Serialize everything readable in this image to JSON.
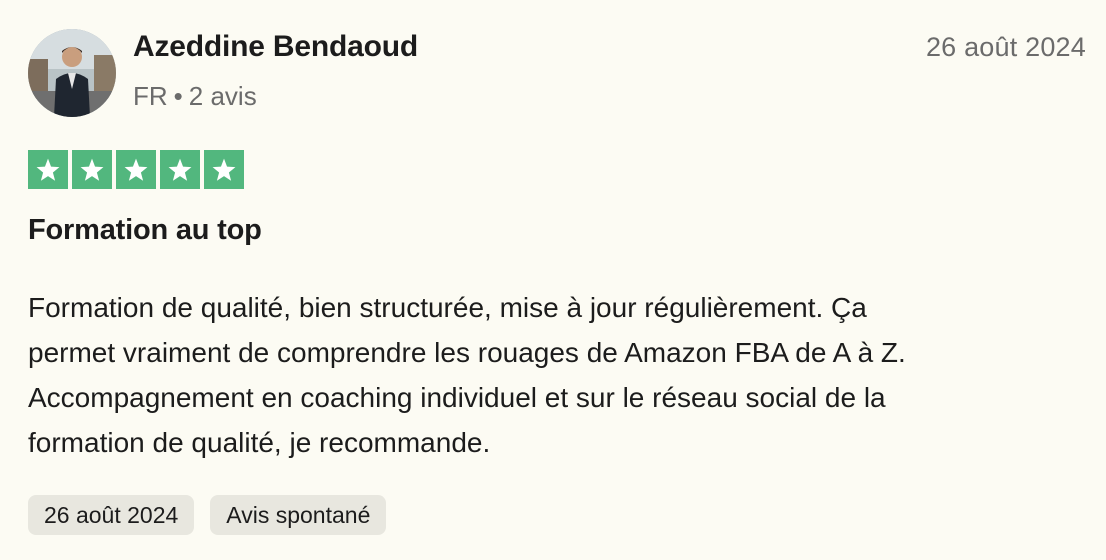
{
  "reviewer": {
    "name": "Azeddine Bendaoud",
    "country": "FR",
    "separator": "•",
    "review_count": "2 avis"
  },
  "review": {
    "date": "26 août 2024",
    "rating": 5,
    "rating_max": 5,
    "star_color": "#52b77e",
    "title": "Formation au top",
    "body_lines": [
      "Formation de qualité, bien structurée, mise à jour régulièrement. Ça",
      "permet vraiment de comprendre les rouages de Amazon FBA de A à Z.",
      "Accompagnement en coaching individuel et sur le réseau social de la",
      "formation de qualité, je recommande."
    ]
  },
  "tags": {
    "date": "26 août 2024",
    "type": "Avis spontané"
  },
  "icons": {
    "avatar": "avatar-photo",
    "star": "star-icon"
  }
}
